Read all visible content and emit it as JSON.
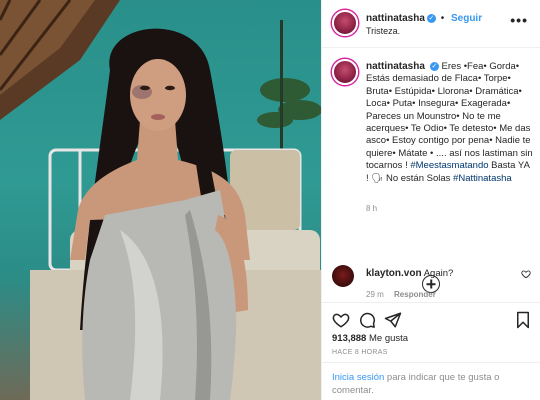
{
  "post": {
    "username": "nattinatasha",
    "follow_label": "Seguir",
    "dot": "•",
    "location": "Tristeza.",
    "more_label": "•••",
    "verified_mark": "✓"
  },
  "caption": {
    "username": "nattinatasha",
    "text_1": "Eres •Fea• Gorda• Estás demasiado de Flaca• Torpe• Bruta• Estúpida• Llorona• Dramática• Loca• Puta• Insegura• Exagerada• Pareces un Mounstro• No te me acerques• Te Odio• Te detesto• Me das asco• Estoy contigo por pena• Nadie te quiere• Mátate • .... así nos lastiman sin tocarnos !",
    "hashtag_1": "#Meestasmatando",
    "text_2": " Basta YA ! 🗣 No están Solas ",
    "hashtag_2": "#Nattinatasha",
    "time": "8 h"
  },
  "comments": [
    {
      "username": "klayton.von",
      "text": "Again?",
      "time": "29 m",
      "reply_label": "Responder"
    }
  ],
  "stats": {
    "likes_count": "913,888",
    "likes_label": "Me gusta",
    "posted": "HACE 8 HORAS"
  },
  "login": {
    "link": "Inicia sesión",
    "text": " para indicar que te gusta o comentar."
  },
  "icons": {
    "like": "heart-icon",
    "comment": "comment-icon",
    "share": "share-icon",
    "save": "bookmark-icon",
    "load_more": "plus-circle-icon"
  },
  "colors": {
    "link_blue": "#3897f0",
    "hashtag": "#00376b",
    "muted": "#8e8e8e",
    "text": "#262626"
  }
}
